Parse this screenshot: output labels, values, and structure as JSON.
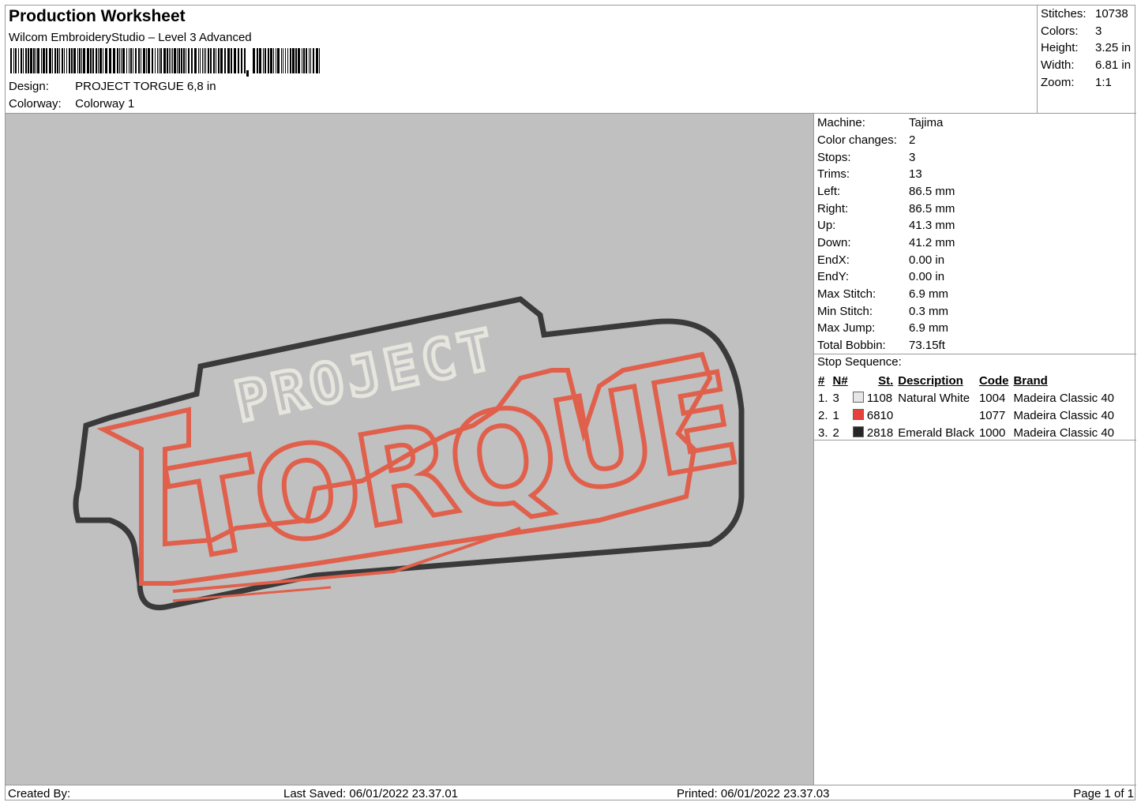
{
  "header": {
    "title": "Production Worksheet",
    "software": "Wilcom EmbroideryStudio – Level 3 Advanced",
    "design_label": "Design:",
    "design_value": "PROJECT TORGUE 6,8 in",
    "colorway_label": "Colorway:",
    "colorway_value": "Colorway 1"
  },
  "summary": [
    {
      "label": "Stitches:",
      "value": "10738"
    },
    {
      "label": "Colors:",
      "value": "3"
    },
    {
      "label": "Height:",
      "value": "3.25 in"
    },
    {
      "label": "Width:",
      "value": "6.81 in"
    },
    {
      "label": "Zoom:",
      "value": "1:1"
    }
  ],
  "machine_info": [
    {
      "label": "Machine:",
      "value": "Tajima"
    },
    {
      "label": "Color changes:",
      "value": "2"
    },
    {
      "label": "Stops:",
      "value": "3"
    },
    {
      "label": "Trims:",
      "value": "13"
    },
    {
      "label": "Left:",
      "value": "86.5 mm"
    },
    {
      "label": "Right:",
      "value": "86.5 mm"
    },
    {
      "label": "Up:",
      "value": "41.3 mm"
    },
    {
      "label": "Down:",
      "value": "41.2 mm"
    },
    {
      "label": "EndX:",
      "value": "0.00 in"
    },
    {
      "label": "EndY:",
      "value": "0.00 in"
    },
    {
      "label": "Max Stitch:",
      "value": "6.9 mm"
    },
    {
      "label": "Min Stitch:",
      "value": "0.3 mm"
    },
    {
      "label": "Max Jump:",
      "value": "6.9 mm"
    },
    {
      "label": "Total Bobbin:",
      "value": "73.15ft"
    }
  ],
  "stop_sequence": {
    "title": "Stop Sequence:",
    "headers": {
      "num": "#",
      "n": "N#",
      "st": "St.",
      "desc": "Description",
      "code": "Code",
      "brand": "Brand"
    },
    "rows": [
      {
        "num": "1.",
        "n": "3",
        "color": "#e6e6e6",
        "st": "1108",
        "desc": "Natural White",
        "code": "1004",
        "brand": "Madeira Classic 40"
      },
      {
        "num": "2.",
        "n": "1",
        "color": "#e8403a",
        "st": "6810",
        "desc": "",
        "code": "1077",
        "brand": "Madeira Classic 40"
      },
      {
        "num": "3.",
        "n": "2",
        "color": "#262626",
        "st": "2818",
        "desc": "Emerald Black",
        "code": "1000",
        "brand": "Madeira Classic 40"
      }
    ]
  },
  "design_preview": {
    "line1": "PROJECT",
    "line2": "TORQUE",
    "colors": {
      "outline": "#3a3a3a",
      "red": "#e0604c",
      "white": "#e6e6de",
      "background": "#c0c0c0"
    }
  },
  "footer": {
    "created_by": "Created By:",
    "last_saved": "Last Saved: 06/01/2022 23.37.01",
    "printed": "Printed: 06/01/2022 23.37.03",
    "page": "Page 1 of 1"
  }
}
